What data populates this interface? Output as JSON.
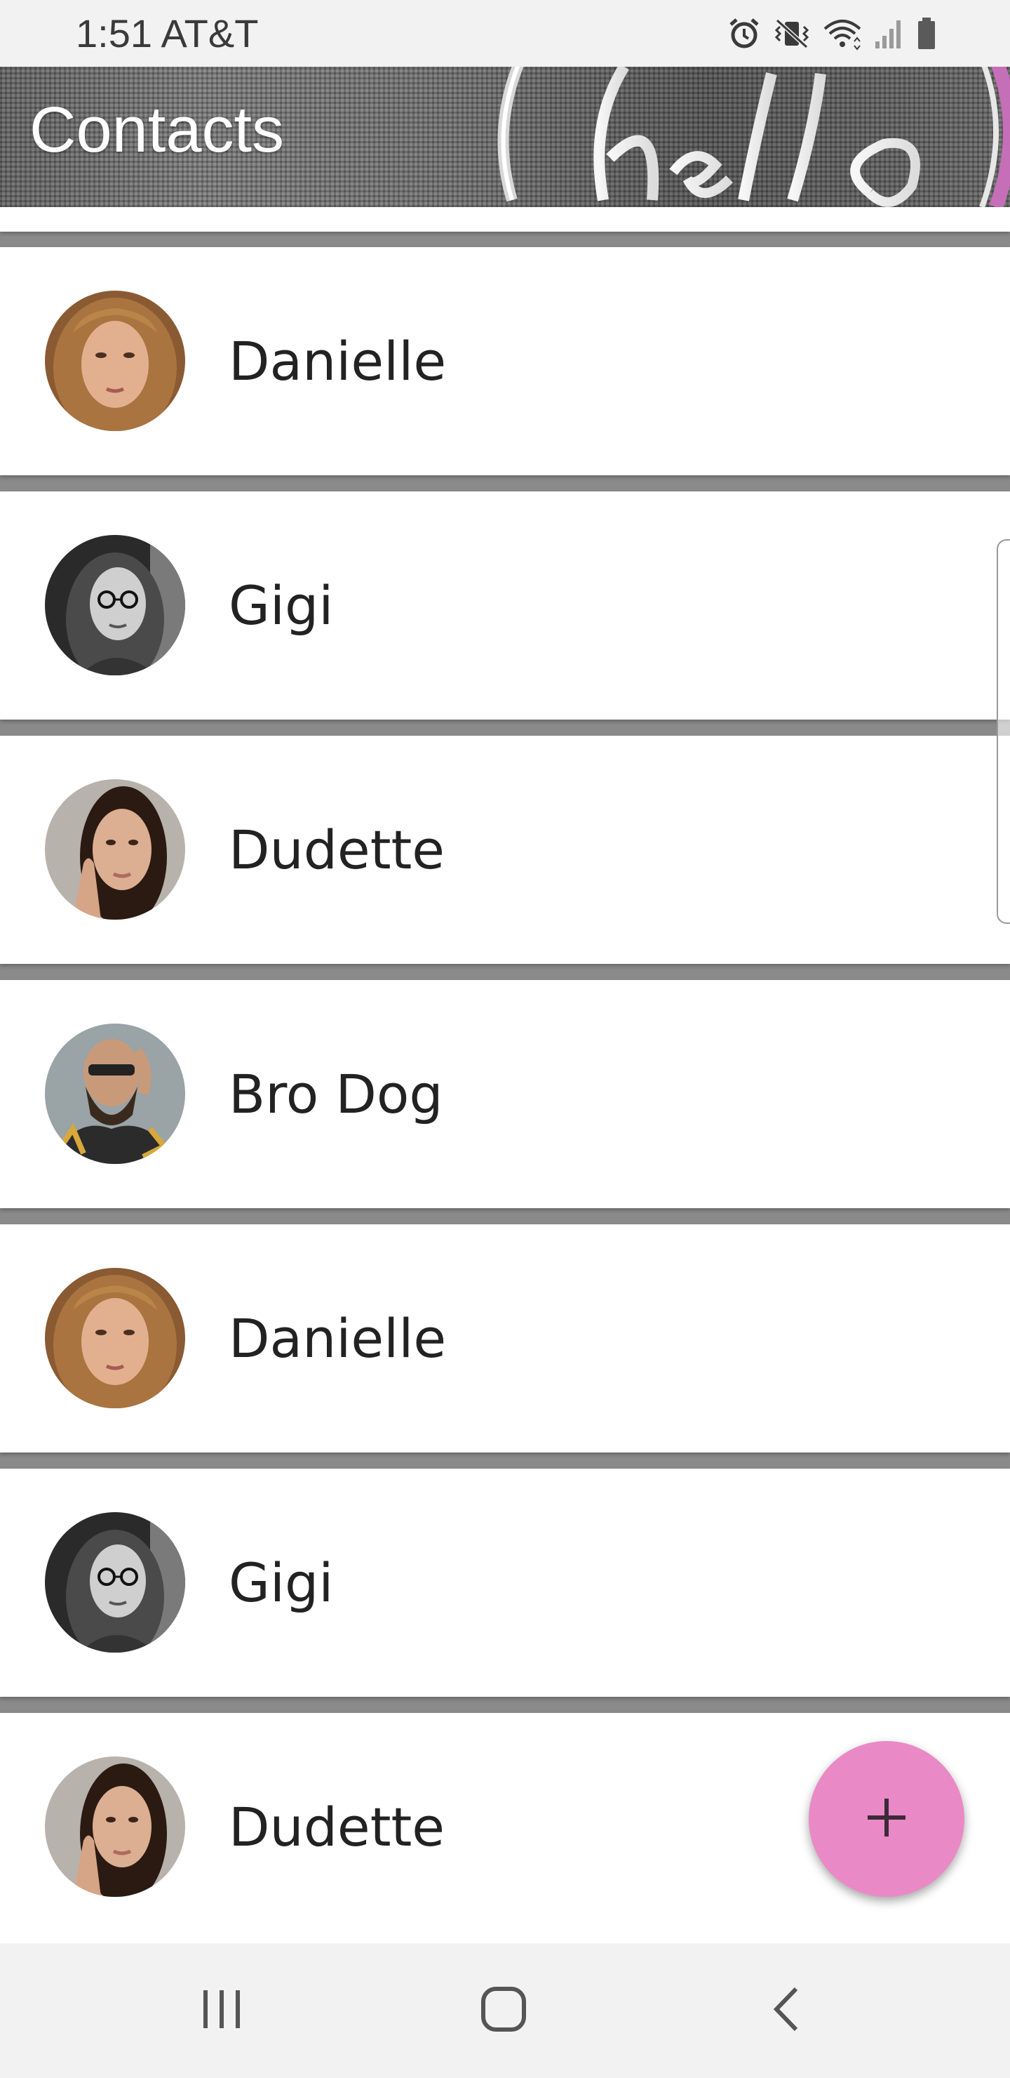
{
  "status_bar": {
    "time_carrier": "1:51 AT&T",
    "icons": [
      "alarm-icon",
      "vibrate-mute-icon",
      "wifi-icon",
      "signal-icon",
      "battery-icon"
    ]
  },
  "app_bar": {
    "title": "Contacts",
    "background_image": "neon-hello-sign"
  },
  "contacts": [
    {
      "name": "Danielle",
      "avatar": "danielle-avatar"
    },
    {
      "name": "Gigi",
      "avatar": "gigi-avatar"
    },
    {
      "name": "Dudette",
      "avatar": "dudette-avatar"
    },
    {
      "name": "Bro Dog",
      "avatar": "bro-dog-avatar"
    },
    {
      "name": "Danielle",
      "avatar": "danielle-avatar"
    },
    {
      "name": "Gigi",
      "avatar": "gigi-avatar"
    },
    {
      "name": "Dudette",
      "avatar": "dudette-avatar"
    }
  ],
  "fab": {
    "icon": "plus-icon",
    "color": "#e98ac6"
  },
  "nav_bar": {
    "buttons": [
      "recent-apps-icon",
      "home-icon",
      "back-icon"
    ]
  }
}
